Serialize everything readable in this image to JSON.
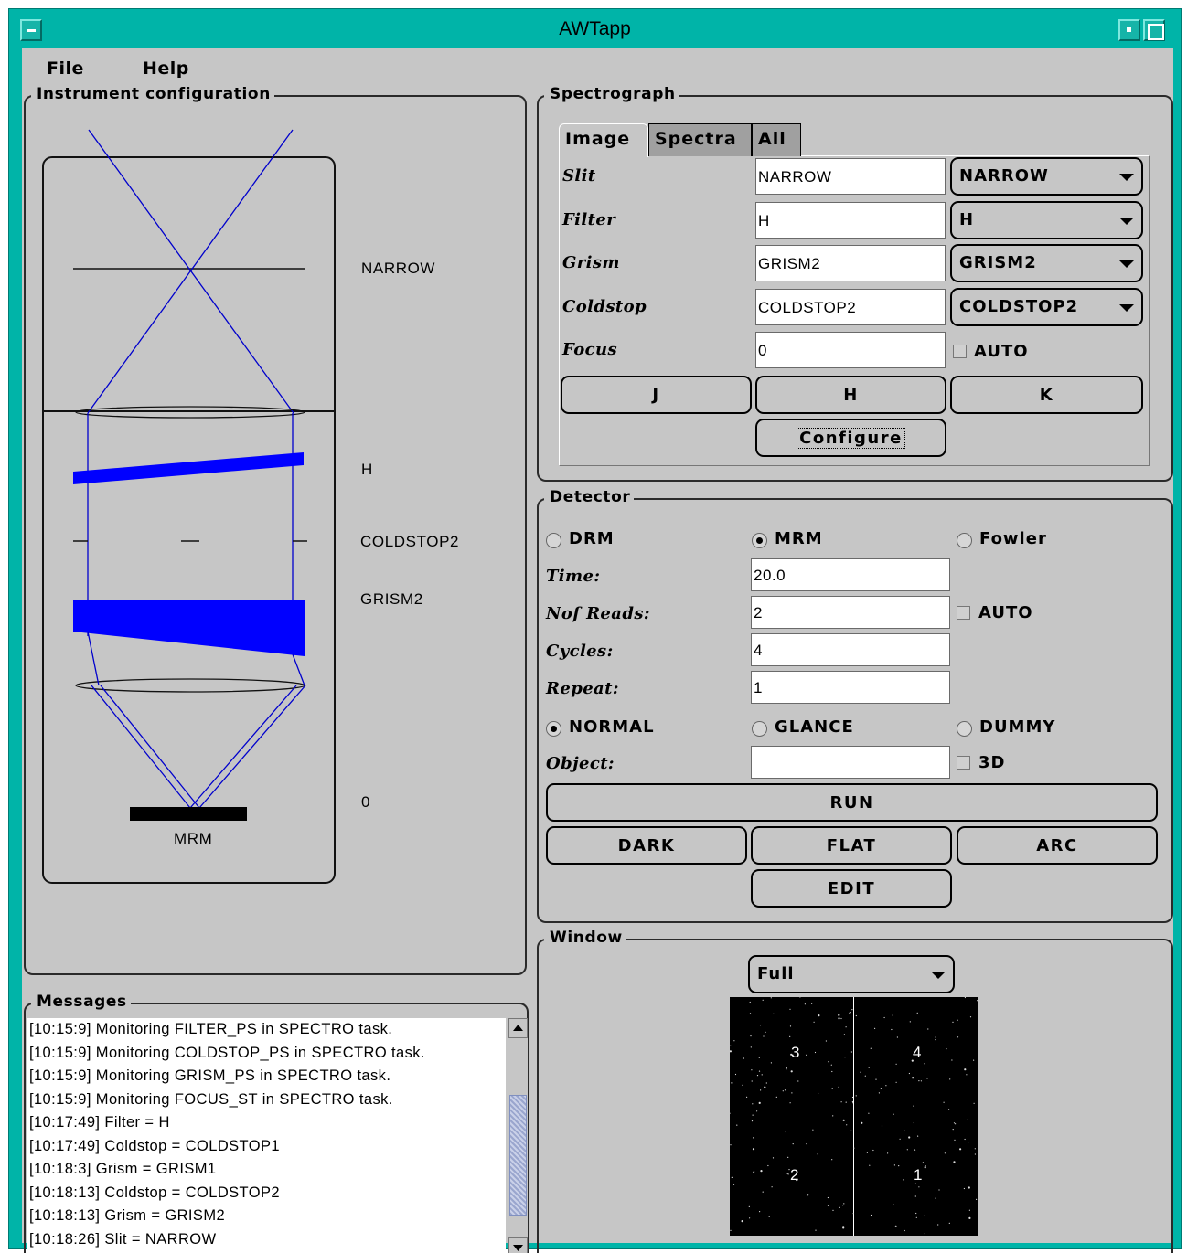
{
  "window": {
    "title": "AWTapp"
  },
  "menu": {
    "file": "File",
    "help": "Help"
  },
  "instrument": {
    "title": "Instrument configuration",
    "labels": {
      "slit": "NARROW",
      "filter": "H",
      "coldstop": "COLDSTOP2",
      "grism": "GRISM2",
      "focus": "0",
      "detector": "MRM"
    }
  },
  "messages": {
    "title": "Messages",
    "lines": [
      "[10:15:9] Monitoring FILTER_PS in SPECTRO task.",
      "[10:15:9] Monitoring COLDSTOP_PS in SPECTRO task.",
      "[10:15:9] Monitoring GRISM_PS in SPECTRO task.",
      "[10:15:9] Monitoring FOCUS_ST in SPECTRO task.",
      "[10:17:49] Filter = H",
      "[10:17:49] Coldstop = COLDSTOP1",
      "[10:18:3] Grism = GRISM1",
      "[10:18:13] Coldstop = COLDSTOP2",
      "[10:18:13] Grism = GRISM2",
      "[10:18:26] Slit = NARROW"
    ]
  },
  "spectrograph": {
    "title": "Spectrograph",
    "tabs": [
      "Image",
      "Spectra",
      "All"
    ],
    "active_tab": "Image",
    "rows": {
      "slit": {
        "label": "Slit",
        "value": "NARROW",
        "select": "NARROW"
      },
      "filter": {
        "label": "Filter",
        "value": "H",
        "select": "H"
      },
      "grism": {
        "label": "Grism",
        "value": "GRISM2",
        "select": "GRISM2"
      },
      "coldstop": {
        "label": "Coldstop",
        "value": "COLDSTOP2",
        "select": "COLDSTOP2"
      },
      "focus": {
        "label": "Focus",
        "value": "0",
        "auto_label": "AUTO",
        "auto_checked": false
      }
    },
    "buttons": {
      "j": "J",
      "h": "H",
      "k": "K",
      "configure": "Configure"
    }
  },
  "detector": {
    "title": "Detector",
    "modes": {
      "drm": "DRM",
      "mrm": "MRM",
      "fowler": "Fowler",
      "selected": "MRM"
    },
    "fields": {
      "time": {
        "label": "Time:",
        "value": "20.0"
      },
      "nreads": {
        "label": "Nof Reads:",
        "value": "2",
        "auto_label": "AUTO",
        "auto_checked": false
      },
      "cycles": {
        "label": "Cycles:",
        "value": "4"
      },
      "repeat": {
        "label": "Repeat:",
        "value": "1"
      },
      "object": {
        "label": "Object:",
        "value": "",
        "threed_label": "3D",
        "threed_checked": false
      }
    },
    "run_modes": {
      "normal": "NORMAL",
      "glance": "GLANCE",
      "dummy": "DUMMY",
      "selected": "NORMAL"
    },
    "buttons": {
      "run": "RUN",
      "dark": "DARK",
      "flat": "FLAT",
      "arc": "ARC",
      "edit": "EDIT"
    }
  },
  "window_panel": {
    "title": "Window",
    "select": "Full",
    "quadrants": [
      "3",
      "4",
      "2",
      "1"
    ]
  },
  "colors": {
    "titlebar": "#00b4a8",
    "background": "#c6c6c6",
    "beam": "#0000cc",
    "element_fill": "#0000ff"
  }
}
